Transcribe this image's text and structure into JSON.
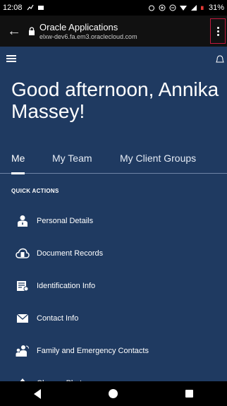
{
  "status_bar": {
    "time": "12:08",
    "battery": "31%"
  },
  "browser": {
    "page_title": "Oracle Applications",
    "url": "elxw-dev6.fa.em3.oraclecloud.com"
  },
  "greeting": "Good afternoon, Annika Massey!",
  "tabs": [
    {
      "label": "Me",
      "active": true
    },
    {
      "label": "My Team",
      "active": false
    },
    {
      "label": "My Client Groups",
      "active": false
    }
  ],
  "quick_actions": {
    "header": "QUICK ACTIONS",
    "items": [
      {
        "label": "Personal Details",
        "icon": "person-icon"
      },
      {
        "label": "Document Records",
        "icon": "document-cloud-icon"
      },
      {
        "label": "Identification Info",
        "icon": "id-card-icon"
      },
      {
        "label": "Contact Info",
        "icon": "envelope-icon"
      },
      {
        "label": "Family and Emergency Contacts",
        "icon": "family-icon"
      },
      {
        "label": "Change Photo",
        "icon": "upload-arrow-icon"
      }
    ]
  },
  "colors": {
    "background": "#1f3a61",
    "highlight_border": "#c2183d"
  }
}
